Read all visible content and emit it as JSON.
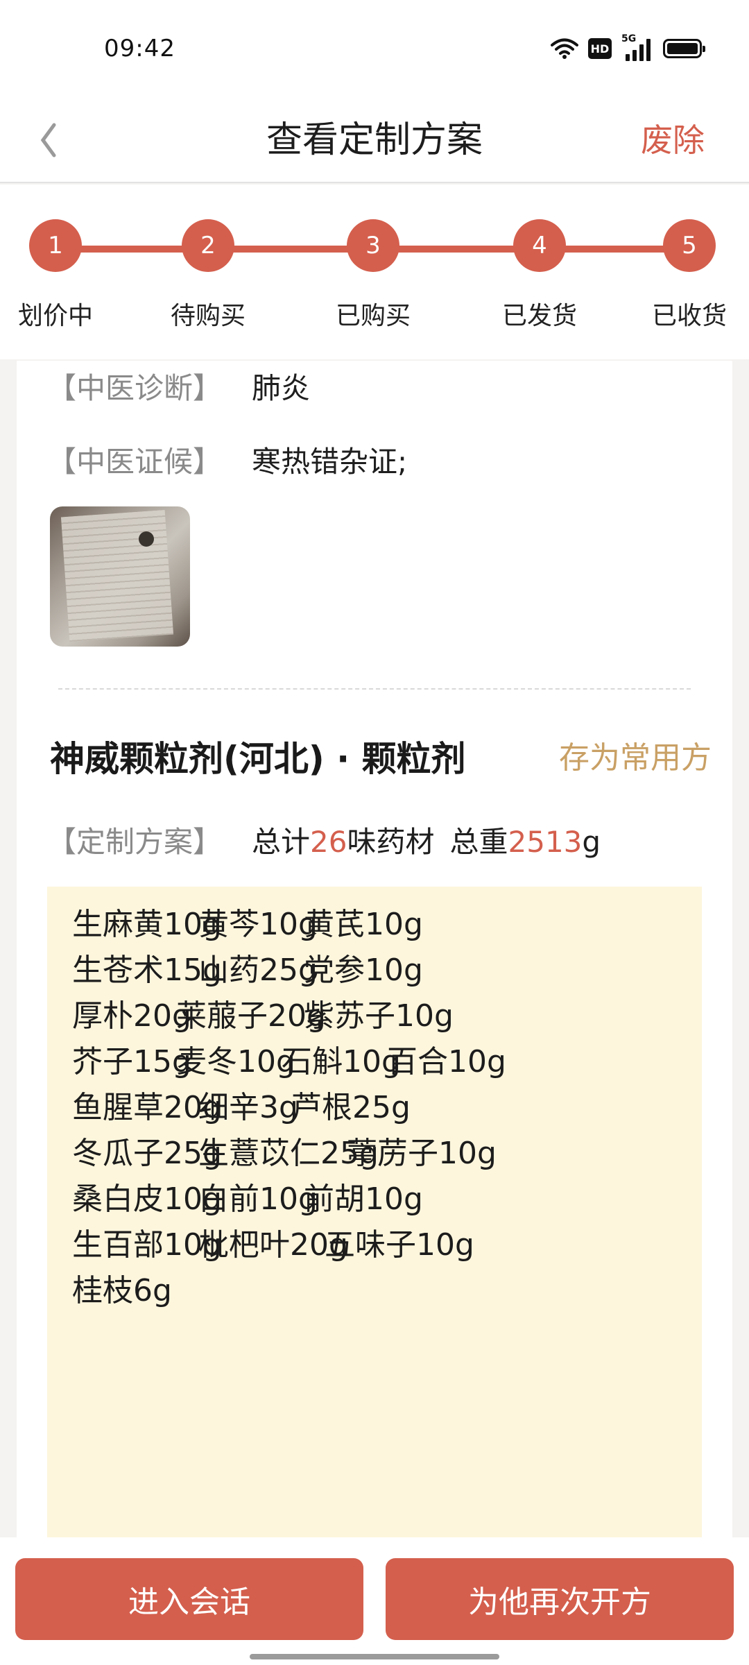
{
  "status_bar": {
    "time": "09:42",
    "hd": "HD",
    "network": "5G"
  },
  "header": {
    "title": "查看定制方案",
    "discard_label": "废除",
    "back_icon": "back-icon"
  },
  "progress": {
    "steps": [
      {
        "number": "1",
        "label": "划价中"
      },
      {
        "number": "2",
        "label": "待购买"
      },
      {
        "number": "3",
        "label": "已购买"
      },
      {
        "number": "4",
        "label": "已发货"
      },
      {
        "number": "5",
        "label": "已收货"
      }
    ]
  },
  "diagnosis": {
    "tcm_diagnosis_label": "【中医诊断】",
    "tcm_diagnosis_value": "肺炎",
    "tcm_syndrome_label": "【中医证候】",
    "tcm_syndrome_value": "寒热错杂证;"
  },
  "prescription": {
    "title": "神威颗粒剂(河北) · 颗粒剂",
    "save_label": "存为常用方",
    "plan_label": "【定制方案】",
    "summary_prefix": "总计",
    "herb_count": "26",
    "summary_mid": "味药材",
    "weight_prefix": "总重",
    "total_weight": "2513",
    "weight_unit": "g",
    "herbs": [
      [
        "生麻黄10g",
        "黄芩10g",
        "黄芪10g"
      ],
      [
        "生苍术15g",
        "山药25g",
        "党参10g"
      ],
      [
        "厚朴20g",
        "莱菔子20g",
        "紫苏子10g"
      ],
      [
        "芥子15g",
        "麦冬10g",
        "石斛10g",
        "百合10g"
      ],
      [
        "鱼腥草20g",
        "细辛3g",
        "芦根25g"
      ],
      [
        "冬瓜子25g",
        "生薏苡仁25g",
        "葶苈子10g"
      ],
      [
        "桑白皮10g",
        "白前10g",
        "前胡10g"
      ],
      [
        "生百部10g",
        "枇杷叶20g",
        "五味子10g"
      ],
      [
        "桂枝6g"
      ]
    ]
  },
  "footer": {
    "chat_button": "进入会话",
    "reopen_button": "为他再次开方"
  },
  "colors": {
    "accent": "#d45f4d",
    "gold": "#c9a065",
    "herb_bg": "#fdf6dd"
  }
}
